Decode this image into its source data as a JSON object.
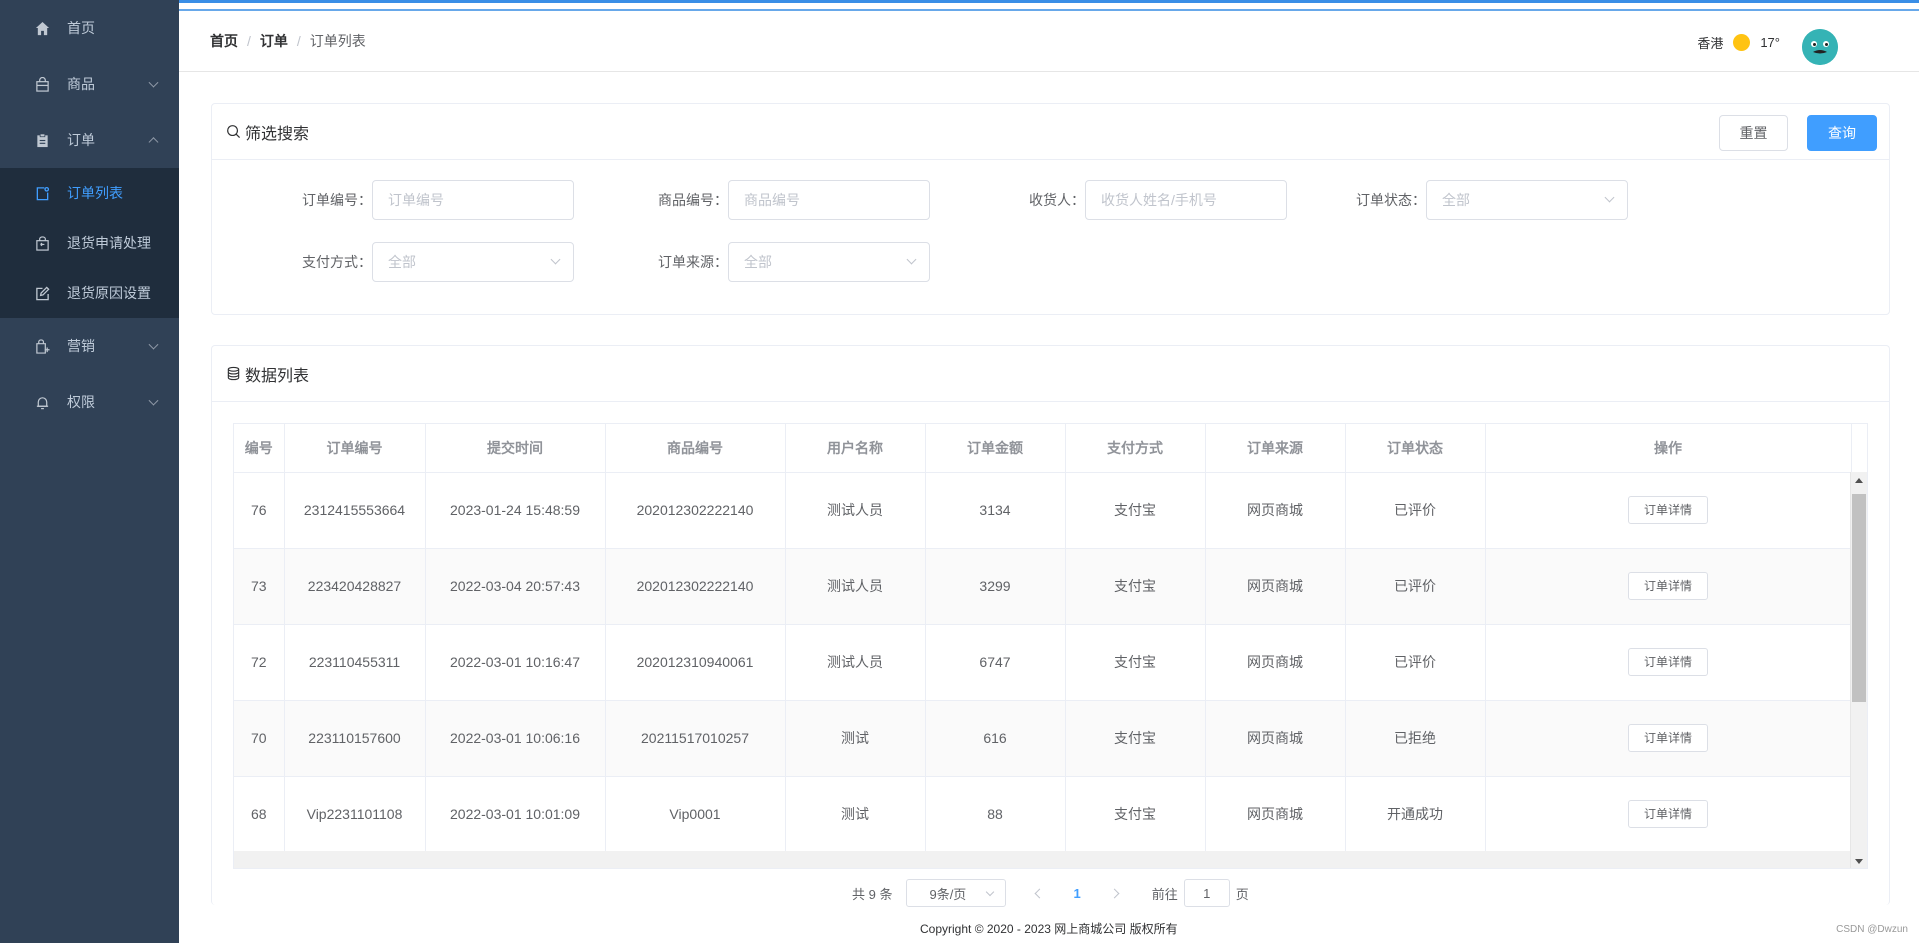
{
  "sidebar": {
    "items": [
      {
        "label": "首页",
        "icon": "home-icon"
      },
      {
        "label": "商品",
        "icon": "shopping-bag-icon"
      },
      {
        "label": "订单",
        "icon": "clipboard-icon"
      }
    ],
    "order_sub": [
      {
        "label": "订单列表",
        "icon": "order-list-icon"
      },
      {
        "label": "退货申请处理",
        "icon": "return-box-icon"
      },
      {
        "label": "退货原因设置",
        "icon": "edit-icon"
      }
    ],
    "items_after": [
      {
        "label": "营销",
        "icon": "marketing-bag-icon"
      },
      {
        "label": "权限",
        "icon": "bell-icon"
      }
    ],
    "active_color": "#409eff"
  },
  "header": {
    "breadcrumb": [
      "首页",
      "订单",
      "订单列表"
    ],
    "city": "香港",
    "temperature": "17°"
  },
  "filter": {
    "title": "筛选搜索",
    "reset_label": "重置",
    "query_label": "查询",
    "fields": {
      "order_no": {
        "label": "订单编号：",
        "placeholder": "订单编号"
      },
      "product_no": {
        "label": "商品编号：",
        "placeholder": "商品编号"
      },
      "receiver": {
        "label": "收货人：",
        "placeholder": "收货人姓名/手机号"
      },
      "status": {
        "label": "订单状态：",
        "value": "全部"
      },
      "pay_method": {
        "label": "支付方式：",
        "value": "全部"
      },
      "source": {
        "label": "订单来源：",
        "value": "全部"
      }
    }
  },
  "datalist": {
    "title": "数据列表",
    "columns": [
      "编号",
      "订单编号",
      "提交时间",
      "商品编号",
      "用户名称",
      "订单金额",
      "支付方式",
      "订单来源",
      "订单状态",
      "操作"
    ],
    "action_label": "订单详情",
    "rows": [
      [
        "76",
        "2312415553664",
        "2023-01-24 15:48:59",
        "202012302222140",
        "测试人员",
        "3134",
        "支付宝",
        "网页商城",
        "已评价"
      ],
      [
        "73",
        "223420428827",
        "2022-03-04 20:57:43",
        "202012302222140",
        "测试人员",
        "3299",
        "支付宝",
        "网页商城",
        "已评价"
      ],
      [
        "72",
        "223110455311",
        "2022-03-01 10:16:47",
        "202012310940061",
        "测试人员",
        "6747",
        "支付宝",
        "网页商城",
        "已评价"
      ],
      [
        "70",
        "223110157600",
        "2022-03-01 10:06:16",
        "20211517010257",
        "测试",
        "616",
        "支付宝",
        "网页商城",
        "已拒绝"
      ],
      [
        "68",
        "Vip2231101108",
        "2022-03-01 10:01:09",
        "Vip0001",
        "测试",
        "88",
        "支付宝",
        "网页商城",
        "开通成功"
      ]
    ]
  },
  "pagination": {
    "total": "共 9 条",
    "page_size": "9条/页",
    "current": "1",
    "goto_label": "前往",
    "goto_value": "1",
    "page_suffix": "页"
  },
  "footer": {
    "copyright": "Copyright © 2020 - 2023  网上商城公司 版权所有",
    "watermark": "CSDN @Dwzun"
  }
}
